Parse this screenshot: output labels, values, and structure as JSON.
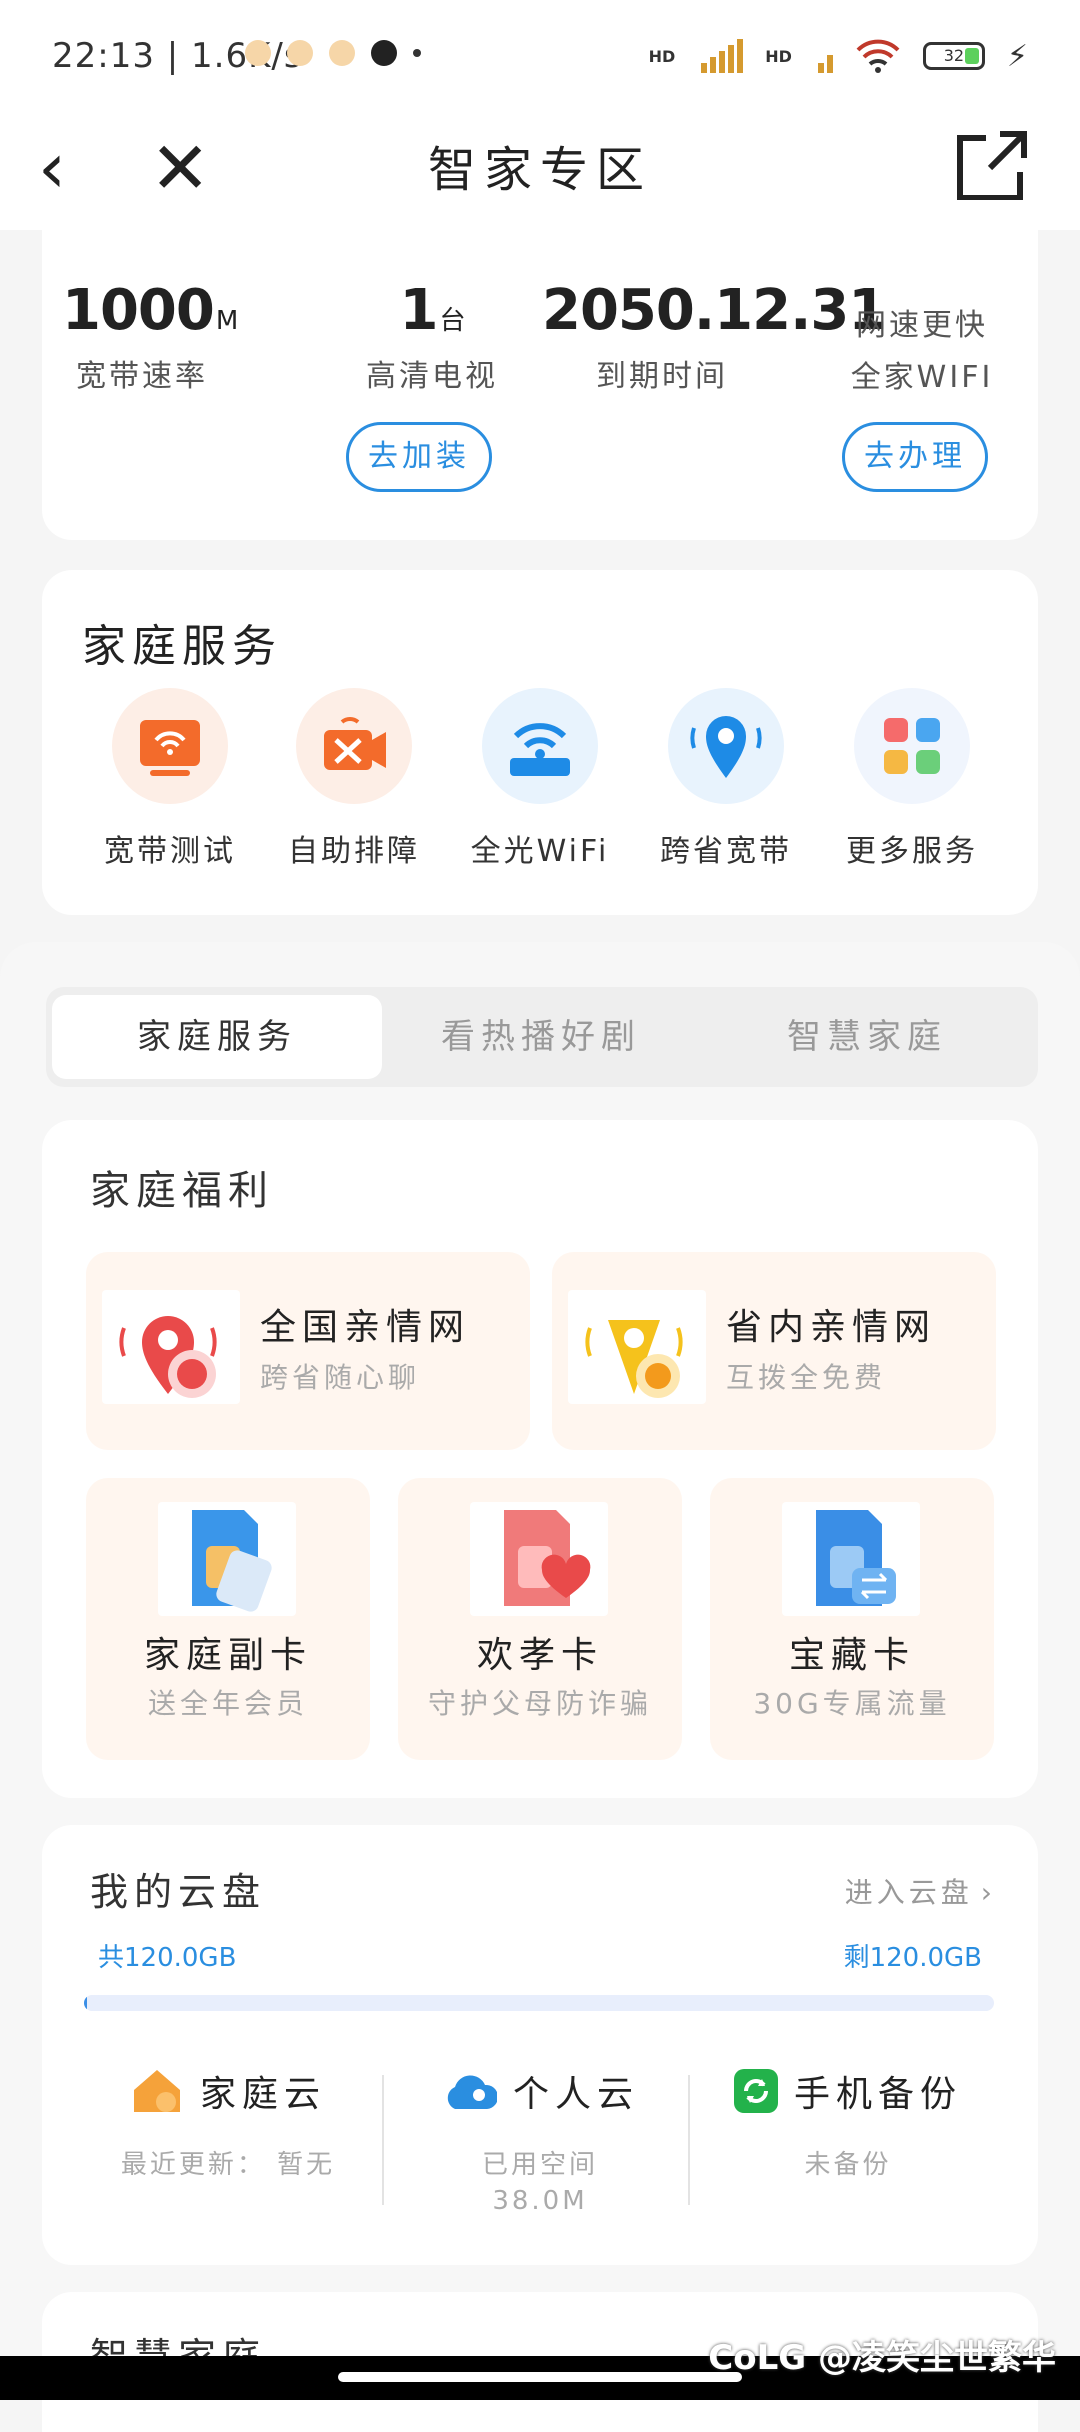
{
  "status": {
    "time": "22:13 | 1.6K/s",
    "hd1": "HD",
    "hd2": "HD",
    "battery": "32"
  },
  "nav": {
    "title": "智家专区"
  },
  "info": {
    "speed_value": "1000",
    "speed_unit": "M",
    "speed_label": "宽带速率",
    "tv_value": "1",
    "tv_unit": "台",
    "tv_label": "高清电视",
    "expire_value": "2050.12.31",
    "expire_label": "到期时间",
    "promo_line1": "网速更快",
    "promo_line2": "全家WIFI",
    "add_button": "去加装",
    "apply_button": "去办理"
  },
  "services": {
    "title": "家庭服务",
    "items": [
      {
        "label": "宽带测试",
        "color": "#f36b2b"
      },
      {
        "label": "自助排障",
        "color": "#f36b2b"
      },
      {
        "label": "全光WiFi",
        "color": "#1e8be6"
      },
      {
        "label": "跨省宽带",
        "color": "#1e8be6"
      },
      {
        "label": "更多服务",
        "color": "#f39a3a"
      }
    ]
  },
  "tabs": [
    {
      "label": "家庭服务"
    },
    {
      "label": "看热播好剧"
    },
    {
      "label": "智慧家庭"
    }
  ],
  "welfare": {
    "title": "家庭福利",
    "big": [
      {
        "title": "全国亲情网",
        "sub": "跨省随心聊"
      },
      {
        "title": "省内亲情网",
        "sub": "互拨全免费"
      }
    ],
    "small": [
      {
        "title": "家庭副卡",
        "sub": "送全年会员"
      },
      {
        "title": "欢孝卡",
        "sub": "守护父母防诈骗"
      },
      {
        "title": "宝藏卡",
        "sub": "30G专属流量"
      }
    ]
  },
  "cloud": {
    "title": "我的云盘",
    "enter": "进入云盘",
    "total": "共120.0GB",
    "remain": "剩120.0GB",
    "used_fraction": 0.003,
    "cols": [
      {
        "name": "家庭云",
        "sub": "最近更新：  暂无"
      },
      {
        "name": "个人云",
        "sub": "已用空间",
        "sub2": "38.0M"
      },
      {
        "name": "手机备份",
        "sub": "未备份"
      }
    ]
  },
  "smart": {
    "title": "智慧家庭"
  },
  "watermark": "CoLG @凌笑尘世繁华"
}
